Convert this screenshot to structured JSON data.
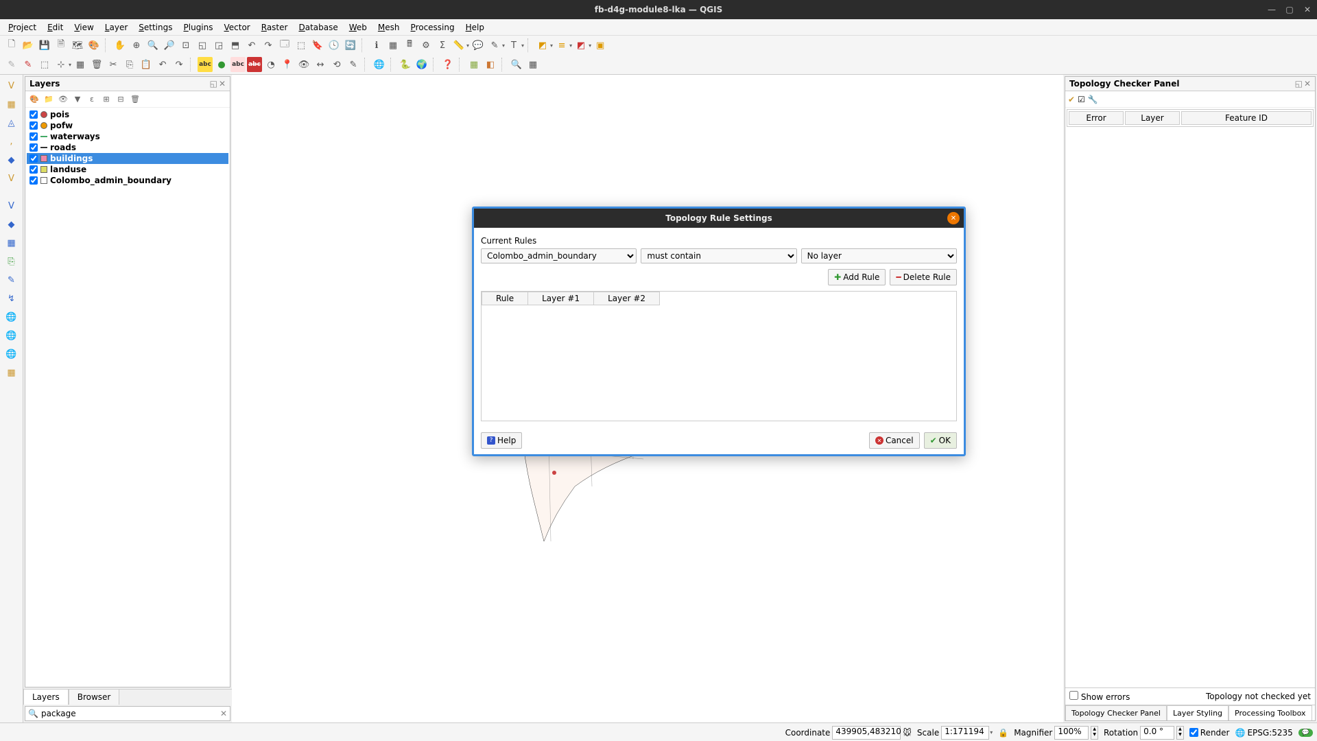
{
  "window": {
    "title": "fb-d4g-module8-lka — QGIS"
  },
  "menubar": [
    "Project",
    "Edit",
    "View",
    "Layer",
    "Settings",
    "Plugins",
    "Vector",
    "Raster",
    "Database",
    "Web",
    "Mesh",
    "Processing",
    "Help"
  ],
  "layers_panel": {
    "title": "Layers",
    "items": [
      {
        "name": "pois",
        "checked": true,
        "sym": "point-red"
      },
      {
        "name": "pofw",
        "checked": true,
        "sym": "point-orange"
      },
      {
        "name": "waterways",
        "checked": true,
        "sym": "line"
      },
      {
        "name": "roads",
        "checked": true,
        "sym": "line-dark"
      },
      {
        "name": "buildings",
        "checked": true,
        "sym": "poly-pink",
        "selected": true
      },
      {
        "name": "landuse",
        "checked": true,
        "sym": "poly-yellow"
      },
      {
        "name": "Colombo_admin_boundary",
        "checked": true,
        "sym": "poly-white"
      }
    ],
    "tabs": {
      "layers": "Layers",
      "browser": "Browser"
    }
  },
  "topology_panel": {
    "title": "Topology Checker Panel",
    "columns": [
      "Error",
      "Layer",
      "Feature ID"
    ],
    "show_errors": "Show errors",
    "not_checked": "Topology not checked yet",
    "tabs": [
      "Topology Checker Panel",
      "Layer Styling",
      "Processing Toolbox"
    ]
  },
  "dialog": {
    "title": "Topology Rule Settings",
    "current_rules": "Current Rules",
    "layer1": "Colombo_admin_boundary",
    "rule": "must contain",
    "layer2": "No layer",
    "add_rule": "Add Rule",
    "delete_rule": "Delete Rule",
    "columns": [
      "Rule",
      "Layer #1",
      "Layer #2"
    ],
    "help": "Help",
    "cancel": "Cancel",
    "ok": "OK"
  },
  "statusbar": {
    "locator_value": "package",
    "coord_label": "Coordinate",
    "coord_value": "439905,483210",
    "scale_label": "Scale",
    "scale_value": "1:171194",
    "magnifier_label": "Magnifier",
    "magnifier_value": "100%",
    "rotation_label": "Rotation",
    "rotation_value": "0.0 °",
    "render": "Render",
    "crs": "EPSG:5235"
  }
}
